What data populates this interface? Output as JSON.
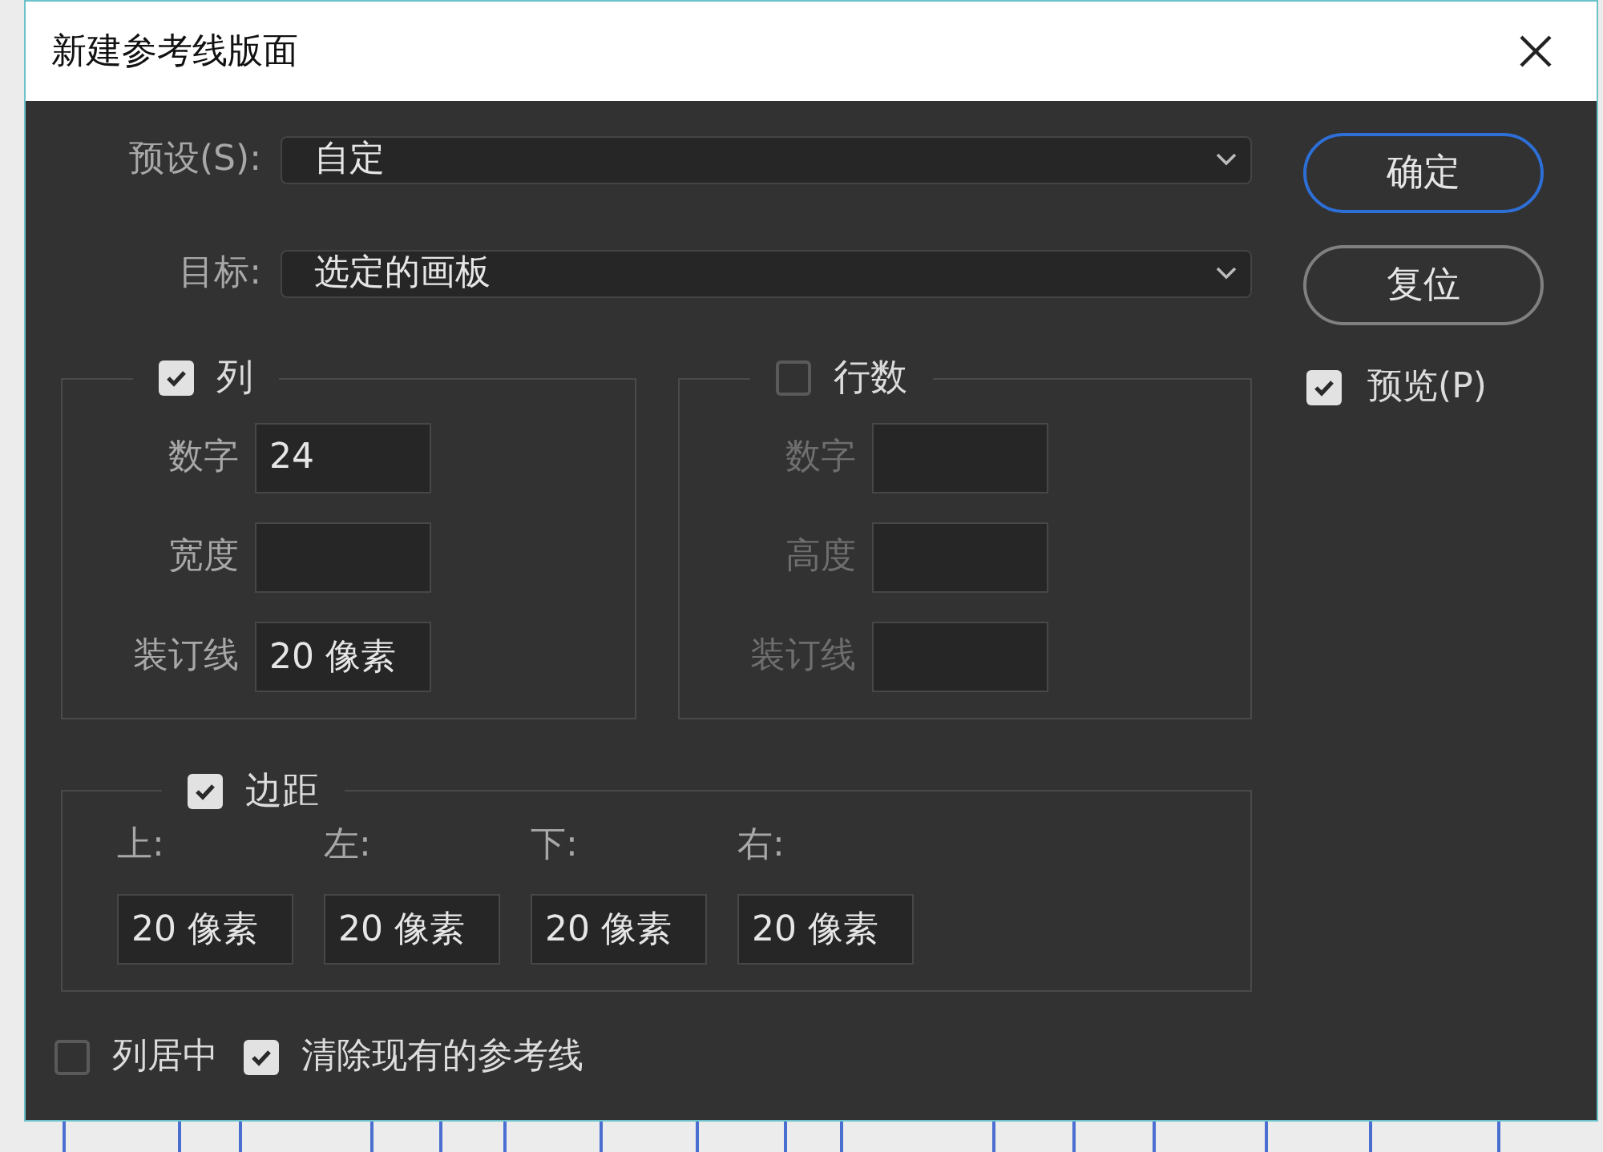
{
  "window": {
    "title": "新建参考线版面"
  },
  "preset": {
    "label": "预设(S):",
    "value": "自定"
  },
  "target": {
    "label": "目标:",
    "value": "选定的画板"
  },
  "columns": {
    "label": "列",
    "checked": true,
    "fields": [
      {
        "label": "数字",
        "value": "24"
      },
      {
        "label": "宽度"
      },
      {
        "label": "装订线",
        "value": "20 像素"
      }
    ]
  },
  "rows": {
    "label": "行数",
    "checked": false,
    "fields": [
      {
        "label": "数字"
      },
      {
        "label": "高度"
      },
      {
        "label": "装订线"
      }
    ]
  },
  "margins": {
    "label": "边距",
    "checked": true,
    "fields": [
      {
        "label": "上:",
        "value": "20 像素"
      },
      {
        "label": "左:",
        "value": "20 像素"
      },
      {
        "label": "下:",
        "value": "20 像素"
      },
      {
        "label": "右:",
        "value": "20 像素"
      }
    ]
  },
  "options": [
    {
      "label": "列居中",
      "checked": false
    },
    {
      "label": "清除现有的参考线",
      "checked": true
    }
  ],
  "buttons": [
    {
      "label": "确定",
      "default": true
    },
    {
      "label": "复位",
      "default": false
    }
  ],
  "preview": {
    "label": "预览(P)",
    "checked": true
  }
}
